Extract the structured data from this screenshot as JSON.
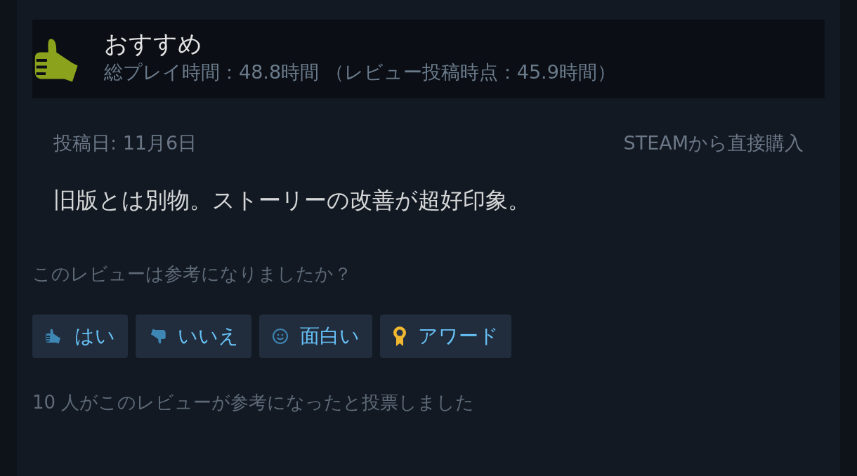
{
  "review": {
    "verdict": "おすすめ",
    "playtime": "総プレイ時間：48.8時間 （レビュー投稿時点：45.9時間）"
  },
  "meta": {
    "posted": "投稿日: 11月6日",
    "source": "STEAMから直接購入"
  },
  "body": "旧版とは別物。ストーリーの改善が超好印象。",
  "helpful_prompt": "このレビューは参考になりましたか？",
  "buttons": [
    {
      "kind": "yes",
      "label": "はい"
    },
    {
      "kind": "no",
      "label": "いいえ"
    },
    {
      "kind": "funny",
      "label": "面白い"
    },
    {
      "kind": "award",
      "label": "アワード"
    }
  ],
  "votes": "10 人がこのレビューが参考になったと投票しました"
}
